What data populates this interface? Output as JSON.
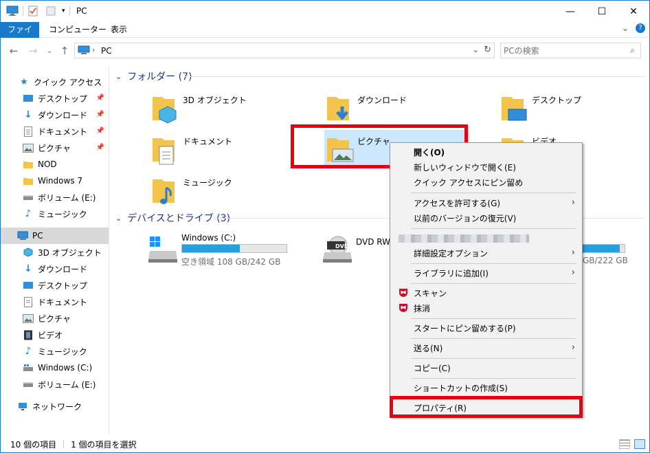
{
  "window": {
    "title": "PC",
    "close": "✕",
    "maximize": "☐",
    "minimize": "—"
  },
  "ribbon": {
    "tabs": [
      "ファイル",
      "コンピューター",
      "表示"
    ],
    "collapse": "⌄",
    "help": "?"
  },
  "navbar": {
    "address": "PC",
    "search_placeholder": "PCの検索"
  },
  "sidebar": {
    "quick_access": "クイック アクセス",
    "quick_items": [
      {
        "label": "デスクトップ",
        "pinned": true
      },
      {
        "label": "ダウンロード",
        "pinned": true
      },
      {
        "label": "ドキュメント",
        "pinned": true
      },
      {
        "label": "ピクチャ",
        "pinned": true
      },
      {
        "label": "NOD",
        "pinned": false
      },
      {
        "label": "Windows 7",
        "pinned": false
      },
      {
        "label": "ボリューム (E:)",
        "pinned": false
      },
      {
        "label": "ミュージック",
        "pinned": false
      }
    ],
    "pc": "PC",
    "pc_items": [
      "3D オブジェクト",
      "ダウンロード",
      "デスクトップ",
      "ドキュメント",
      "ピクチャ",
      "ビデオ",
      "ミュージック",
      "Windows (C:)",
      "ボリューム (E:)"
    ],
    "network": "ネットワーク"
  },
  "content": {
    "folders_header": "フォルダー (7)",
    "folders": [
      "3D オブジェクト",
      "ダウンロード",
      "デスクトップ",
      "ドキュメント",
      "ピクチャ",
      "ビデオ",
      "ミュージック"
    ],
    "drives_header": "デバイスとドライブ (3)",
    "drives": [
      {
        "label": "Windows (C:)",
        "free": "空き領域 108 GB/242 GB",
        "used_fraction": 0.55
      },
      {
        "label": "DVD RW",
        "free": "",
        "used_fraction": 0
      },
      {
        "label": "",
        "free": "GB/222 GB",
        "used_fraction": 0.9
      }
    ]
  },
  "context_menu": {
    "items": [
      "開く(O)",
      "新しいウィンドウで開く(E)",
      "クイック アクセスにピン留め",
      "アクセスを許可する(G)",
      "以前のバージョンの復元(V)",
      "詳細設定オプション",
      "ライブラリに追加(I)",
      "スキャン",
      "抹消",
      "スタートにピン留めする(P)",
      "送る(N)",
      "コピー(C)",
      "ショートカットの作成(S)",
      "プロパティ(R)"
    ]
  },
  "status": {
    "count": "10 個の項目",
    "selected": "1 個の項目を選択"
  },
  "colors": {
    "accent": "#1979ca",
    "highlight": "#e60012",
    "folder": "#f3c44c",
    "selection": "#cce8ff"
  }
}
